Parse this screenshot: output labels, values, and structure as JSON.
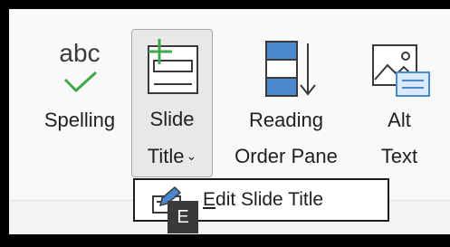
{
  "ribbon": {
    "buttons": [
      {
        "name": "spelling",
        "label_line1": "Spelling",
        "label_line2": "",
        "icon": "abc-check-icon",
        "icon_text": "abc"
      },
      {
        "name": "slide-title",
        "label_line1": "Slide",
        "label_line2": "Title",
        "dropdown_glyph": "⌄",
        "icon": "slide-title-icon",
        "state": "pressed"
      },
      {
        "name": "reading-order-pane",
        "label_line1": "Reading",
        "label_line2": "Order Pane",
        "icon": "reading-order-icon"
      },
      {
        "name": "alt-text",
        "label_line1": "Alt",
        "label_line2": "Text",
        "icon": "alt-text-icon"
      }
    ]
  },
  "menu": {
    "items": [
      {
        "label": "Edit Slide Title",
        "access_key": "E",
        "icon": "edit-title-icon"
      }
    ]
  },
  "keytip": {
    "text": "E"
  },
  "colors": {
    "accent_green": "#3ea84a",
    "accent_blue": "#4a88d0",
    "pressed_bg": "#e8e8e8",
    "frame": "#000000"
  }
}
